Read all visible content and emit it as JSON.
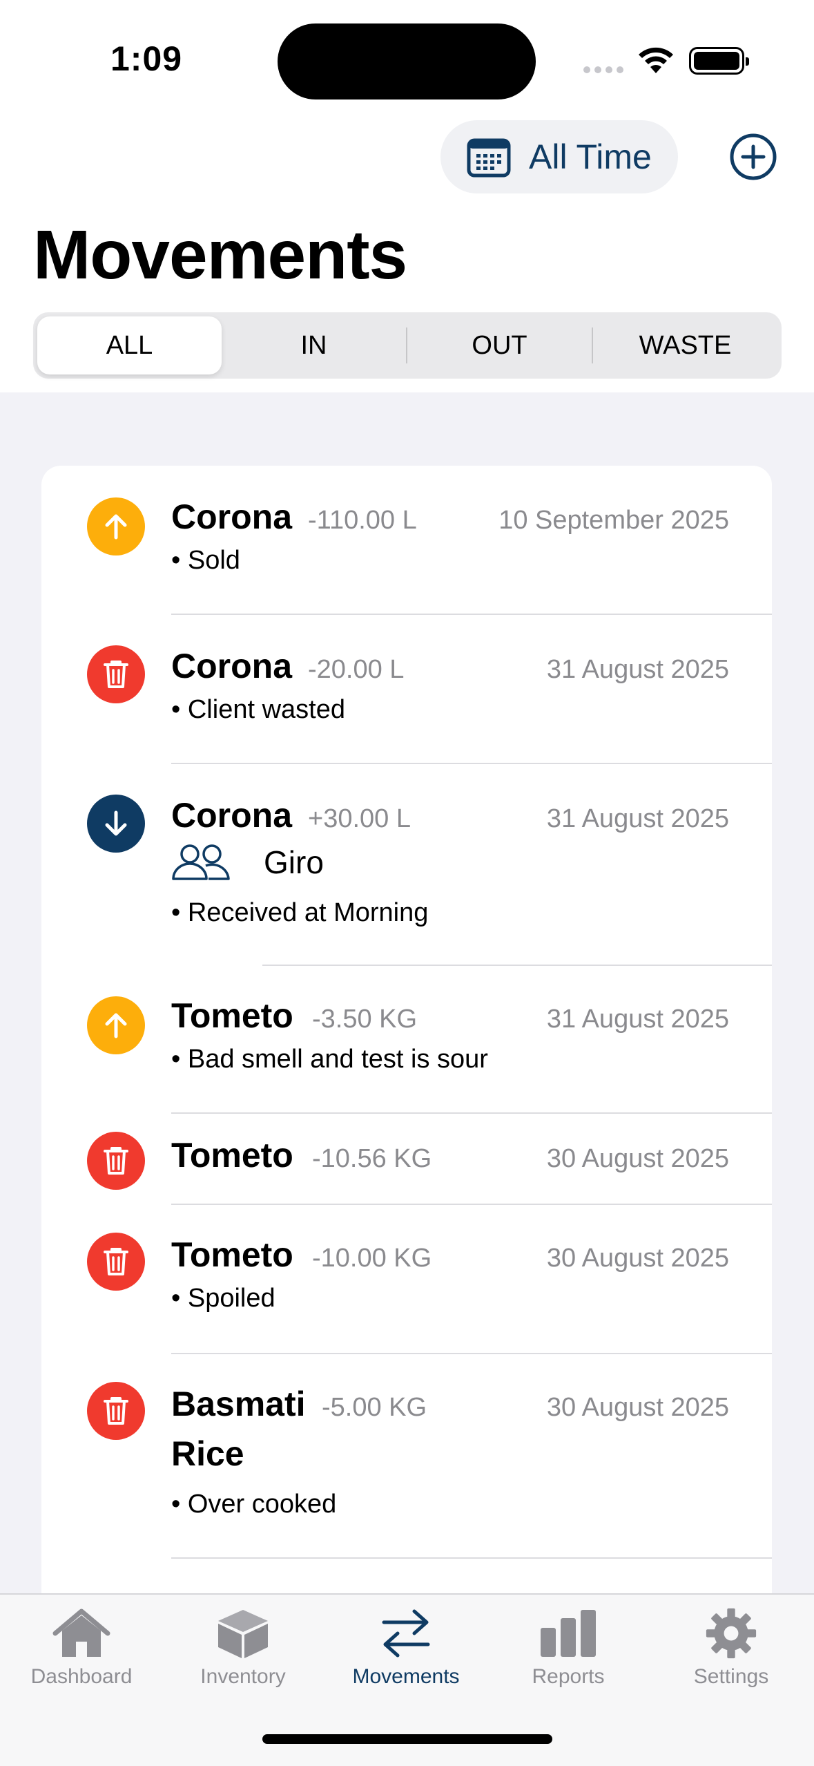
{
  "status_bar": {
    "time": "1:09"
  },
  "header": {
    "filter_label": "All Time",
    "title": "Movements"
  },
  "segments": [
    "ALL",
    "IN",
    "OUT",
    "WASTE"
  ],
  "selected_segment": "ALL",
  "colors": {
    "accent": "#0f3b63",
    "out": "#fdae0b",
    "waste": "#f03a2e",
    "in": "#0f3b63"
  },
  "movements": [
    {
      "type": "out",
      "icon": "arrow-up-icon",
      "name": "Corona",
      "qty": "-110.00 L",
      "date": "10 September 2025",
      "note": "• Sold"
    },
    {
      "type": "waste",
      "icon": "trash-icon",
      "name": "Corona",
      "qty": "-20.00 L",
      "date": "31 August 2025",
      "note": "• Client wasted"
    },
    {
      "type": "in",
      "icon": "arrow-down-icon",
      "name": "Corona",
      "qty": "+30.00 L",
      "date": "31 August 2025",
      "supplier": "Giro",
      "note": "• Received at Morning"
    },
    {
      "type": "out",
      "icon": "arrow-up-icon",
      "name": "Tometo",
      "qty": "-3.50 KG",
      "date": "31 August 2025",
      "note": "• Bad smell and test is sour"
    },
    {
      "type": "waste",
      "icon": "trash-icon",
      "name": "Tometo",
      "qty": "-10.56 KG",
      "date": "30 August 2025",
      "note": ""
    },
    {
      "type": "waste",
      "icon": "trash-icon",
      "name": "Tometo",
      "qty": "-10.00 KG",
      "date": "30 August 2025",
      "note": "• Spoiled"
    },
    {
      "type": "waste",
      "icon": "trash-icon",
      "name_line1": "Basmati",
      "name_line2": "Rice",
      "qty": "-5.00 KG",
      "date": "30 August 2025",
      "note": "• Over cooked"
    }
  ],
  "tabs": [
    {
      "label": "Dashboard",
      "icon": "house-icon"
    },
    {
      "label": "Inventory",
      "icon": "box-icon"
    },
    {
      "label": "Movements",
      "icon": "arrows-icon"
    },
    {
      "label": "Reports",
      "icon": "bar-chart-icon"
    },
    {
      "label": "Settings",
      "icon": "gear-icon"
    }
  ]
}
